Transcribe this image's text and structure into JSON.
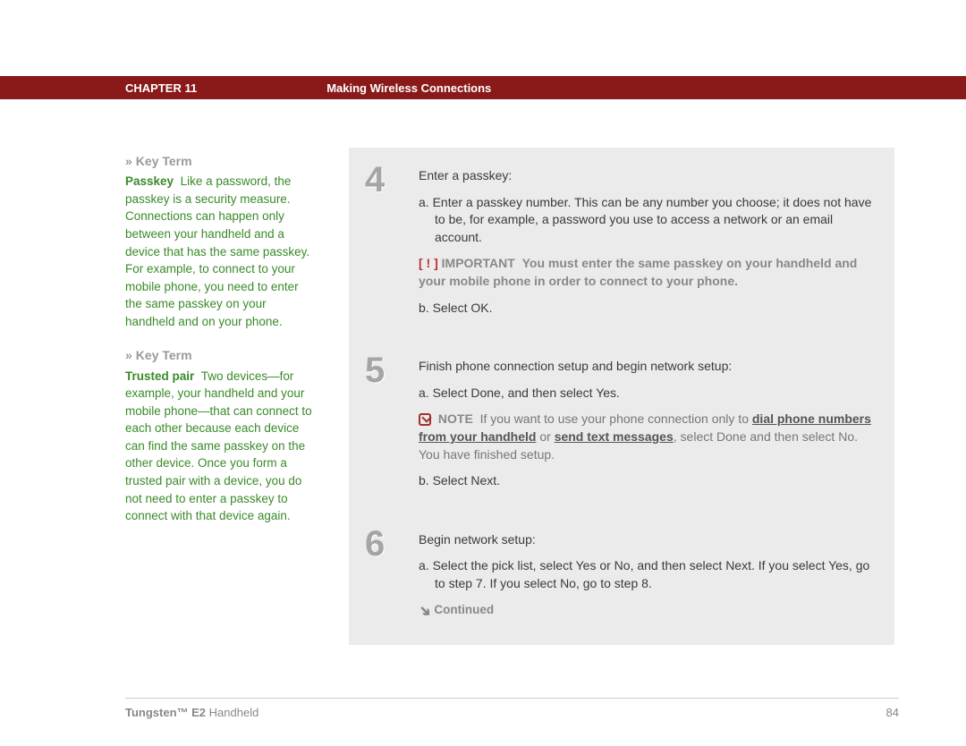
{
  "header": {
    "chapter_label": "CHAPTER 11",
    "chapter_title": "Making Wireless Connections"
  },
  "sidebar": {
    "key_term_label": "Key Term",
    "arrows": "»",
    "blocks": [
      {
        "term": "Passkey",
        "body": "Like a password, the passkey is a security measure. Connections can happen only between your handheld and a device that has the same passkey. For example, to connect to your mobile phone, you need to enter the same passkey on your handheld and on your phone."
      },
      {
        "term": "Trusted pair",
        "body": "Two devices—for example, your handheld and your mobile phone—that can connect to each other because each device can find the same passkey on the other device. Once you form a trusted pair with a device, you do not need to enter a passkey to connect with that device again."
      }
    ]
  },
  "steps": [
    {
      "num": "4",
      "title": "Enter a passkey:",
      "line_a": "a.  Enter a passkey number. This can be any number you choose; it does not have to be, for example, a password you use to access a network or an email account.",
      "important_bang": "[ ! ]",
      "important_label": "IMPORTANT",
      "important_body": "You must enter the same passkey on your handheld and your mobile phone in order to connect to your phone.",
      "line_b": "b.  Select OK."
    },
    {
      "num": "5",
      "title": "Finish phone connection setup and begin network setup:",
      "line_a": "a.  Select Done, and then select Yes.",
      "note_label": "NOTE",
      "note_prefix": "If you want to use your phone connection only to ",
      "note_link1": "dial phone numbers from your handheld",
      "note_mid": " or ",
      "note_link2": "send text messages",
      "note_suffix": ", select Done and then select No. You have finished setup.",
      "line_b": "b.  Select Next."
    },
    {
      "num": "6",
      "title": "Begin network setup:",
      "line_a": "a.  Select the pick list, select Yes or No, and then select Next. If you select Yes, go to step 7. If you select No, go to step 8.",
      "continued": "Continued"
    }
  ],
  "footer": {
    "product_bold": "Tungsten™ E2",
    "product_rest": " Handheld",
    "page_number": "84"
  }
}
